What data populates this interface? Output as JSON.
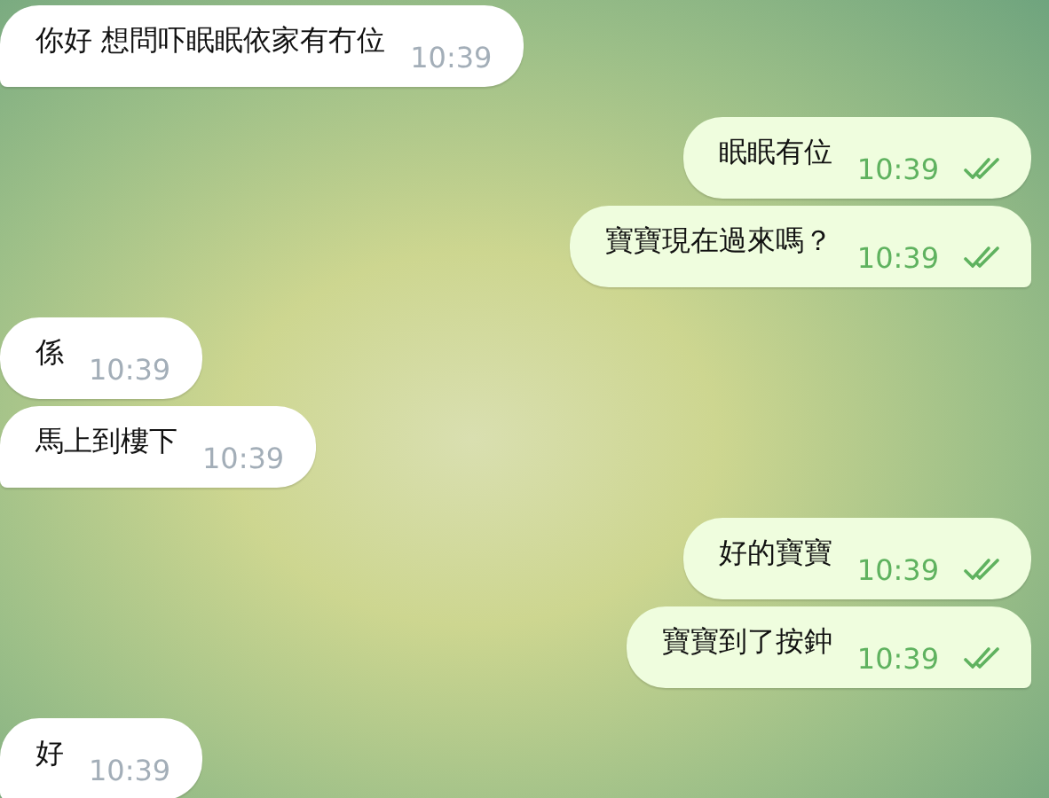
{
  "groups": [
    {
      "kind": "incoming",
      "messages": [
        {
          "text": "你好 想問吓眠眠依家有冇位",
          "time": "10:39"
        }
      ]
    },
    {
      "kind": "outgoing",
      "messages": [
        {
          "text": "眠眠有位",
          "time": "10:39",
          "read": true
        },
        {
          "text": "寶寶現在過來嗎？",
          "time": "10:39",
          "read": true
        }
      ]
    },
    {
      "kind": "incoming",
      "messages": [
        {
          "text": "係",
          "time": "10:39"
        },
        {
          "text": "馬上到樓下",
          "time": "10:39"
        }
      ]
    },
    {
      "kind": "outgoing",
      "messages": [
        {
          "text": "好的寶寶",
          "time": "10:39",
          "read": true
        },
        {
          "text": "寶寶到了按鈡",
          "time": "10:39",
          "read": true
        }
      ]
    },
    {
      "kind": "incoming",
      "messages": [
        {
          "text": "好",
          "time": "10:39"
        }
      ]
    }
  ]
}
